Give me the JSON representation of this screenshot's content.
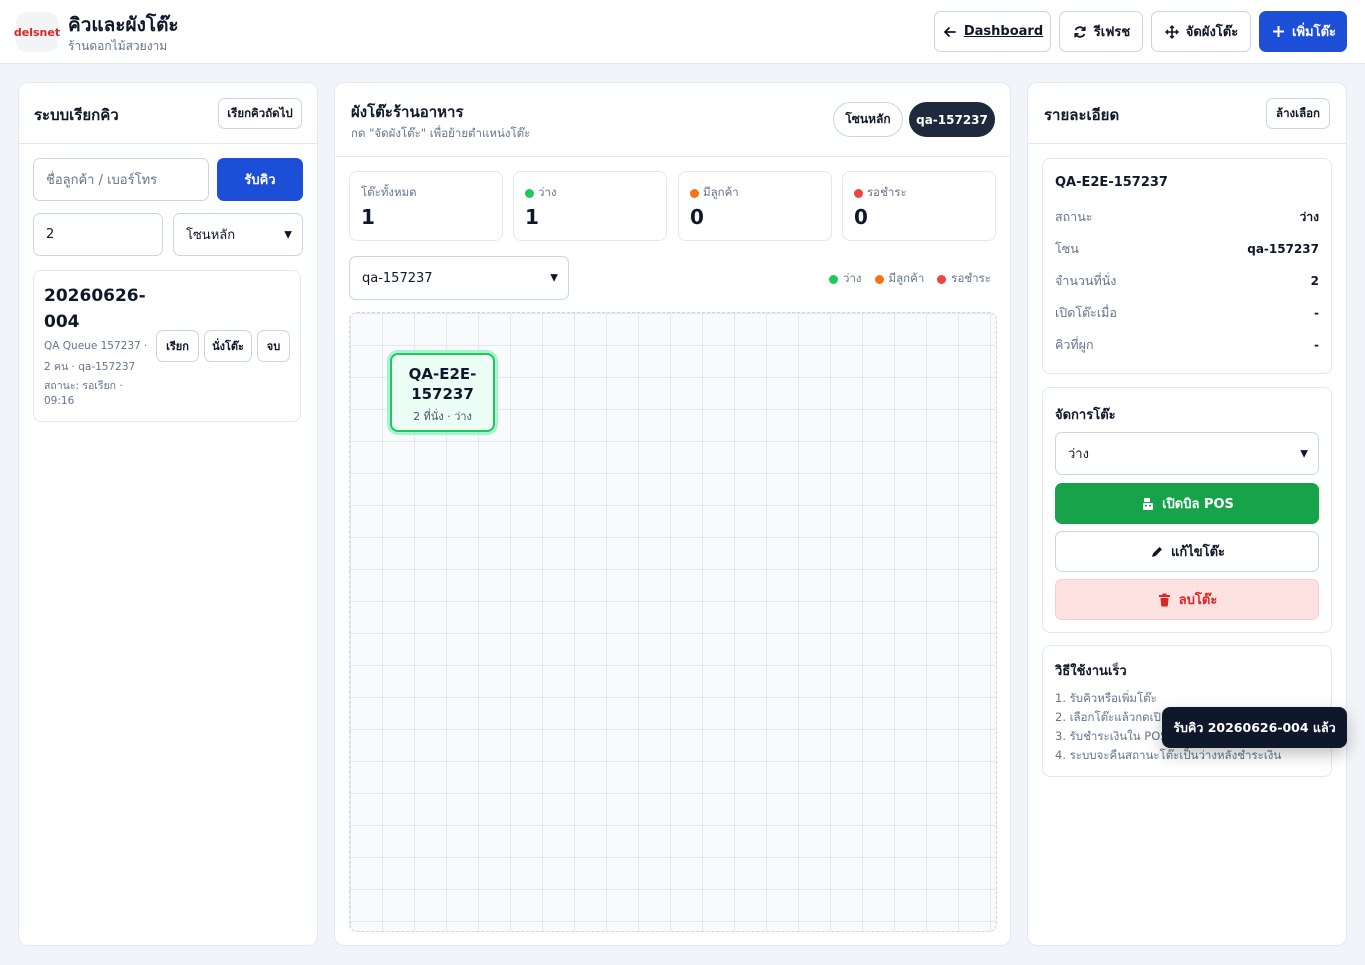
{
  "header": {
    "logo_text": "delsnet",
    "title": "คิวและผังโต๊ะ",
    "subtitle": "ร้านดอกไม้สวยงาม",
    "buttons": {
      "dashboard": "Dashboard",
      "refresh": "รีเฟรช",
      "arrange": "จัดผังโต๊ะ",
      "add_table": "เพิ่มโต๊ะ"
    }
  },
  "queue": {
    "title": "ระบบเรียกคิว",
    "call_next": "เรียกคิวถัดไป",
    "name_placeholder": "ชื่อลูกค้า / เบอร์โทร",
    "take_queue": "รับคิว",
    "party_size": "2",
    "zone_selected": "โซนหลัก",
    "items": [
      {
        "number": "20260626-004",
        "line1": "QA Queue 157237 ·",
        "line2": "2 คน · qa-157237",
        "line3": "สถานะ: รอเรียก ·",
        "line4": "09:16",
        "call": "เรียก",
        "seat": "นั่งโต๊ะ",
        "done": "จบ"
      }
    ]
  },
  "floor": {
    "title": "ผังโต๊ะร้านอาหาร",
    "hint": "กด \"จัดผังโต๊ะ\" เพื่อย้ายตำแหน่งโต๊ะ",
    "zone_tabs": [
      "โซนหลัก",
      "qa-157237"
    ],
    "active_tab": 1,
    "stats": [
      {
        "label": "โต๊ะทั้งหมด",
        "value": "1",
        "color": ""
      },
      {
        "label": "ว่าง",
        "value": "1",
        "color": "#22c55e"
      },
      {
        "label": "มีลูกค้า",
        "value": "0",
        "color": "#f97316"
      },
      {
        "label": "รอชำระ",
        "value": "0",
        "color": "#ef4444"
      }
    ],
    "zone_select": "qa-157237",
    "legend": [
      {
        "label": "ว่าง",
        "color": "#22c55e"
      },
      {
        "label": "มีลูกค้า",
        "color": "#f97316"
      },
      {
        "label": "รอชำระ",
        "color": "#ef4444"
      }
    ],
    "tables": [
      {
        "name_line1": "QA-E2E-",
        "name_line2": "157237",
        "meta": "2 ที่นั่ง · ว่าง"
      }
    ]
  },
  "details": {
    "title": "รายละเอียด",
    "clear": "ล้างเลือก",
    "table_name": "QA-E2E-157237",
    "rows": [
      {
        "k": "สถานะ",
        "v": "ว่าง"
      },
      {
        "k": "โซน",
        "v": "qa-157237"
      },
      {
        "k": "จำนวนที่นั่ง",
        "v": "2"
      },
      {
        "k": "เปิดโต๊ะเมื่อ",
        "v": "-"
      },
      {
        "k": "คิวที่ผูก",
        "v": "-"
      }
    ],
    "manage_title": "จัดการโต๊ะ",
    "status_selected": "ว่าง",
    "open_pos": "เปิดบิล POS",
    "edit": "แก้ไขโต๊ะ",
    "delete": "ลบโต๊ะ",
    "help_title": "วิธีใช้งานเร็ว",
    "help": [
      "1. รับคิวหรือเพิ่มโต๊ะ",
      "2. เลือกโต๊ะแล้วกดเปิ",
      "3. รับชำระเงินใน POS",
      "4. ระบบจะคืนสถานะโต๊ะเป็นว่างหลังชำระเงิน"
    ]
  },
  "toast": "รับคิว 20260626-004 แล้ว",
  "colors": {
    "primary": "#1d4ed8",
    "success": "#16a34a",
    "danger_bg": "#fee2e2",
    "danger_text": "#dc2626",
    "dark": "#0f172a"
  }
}
